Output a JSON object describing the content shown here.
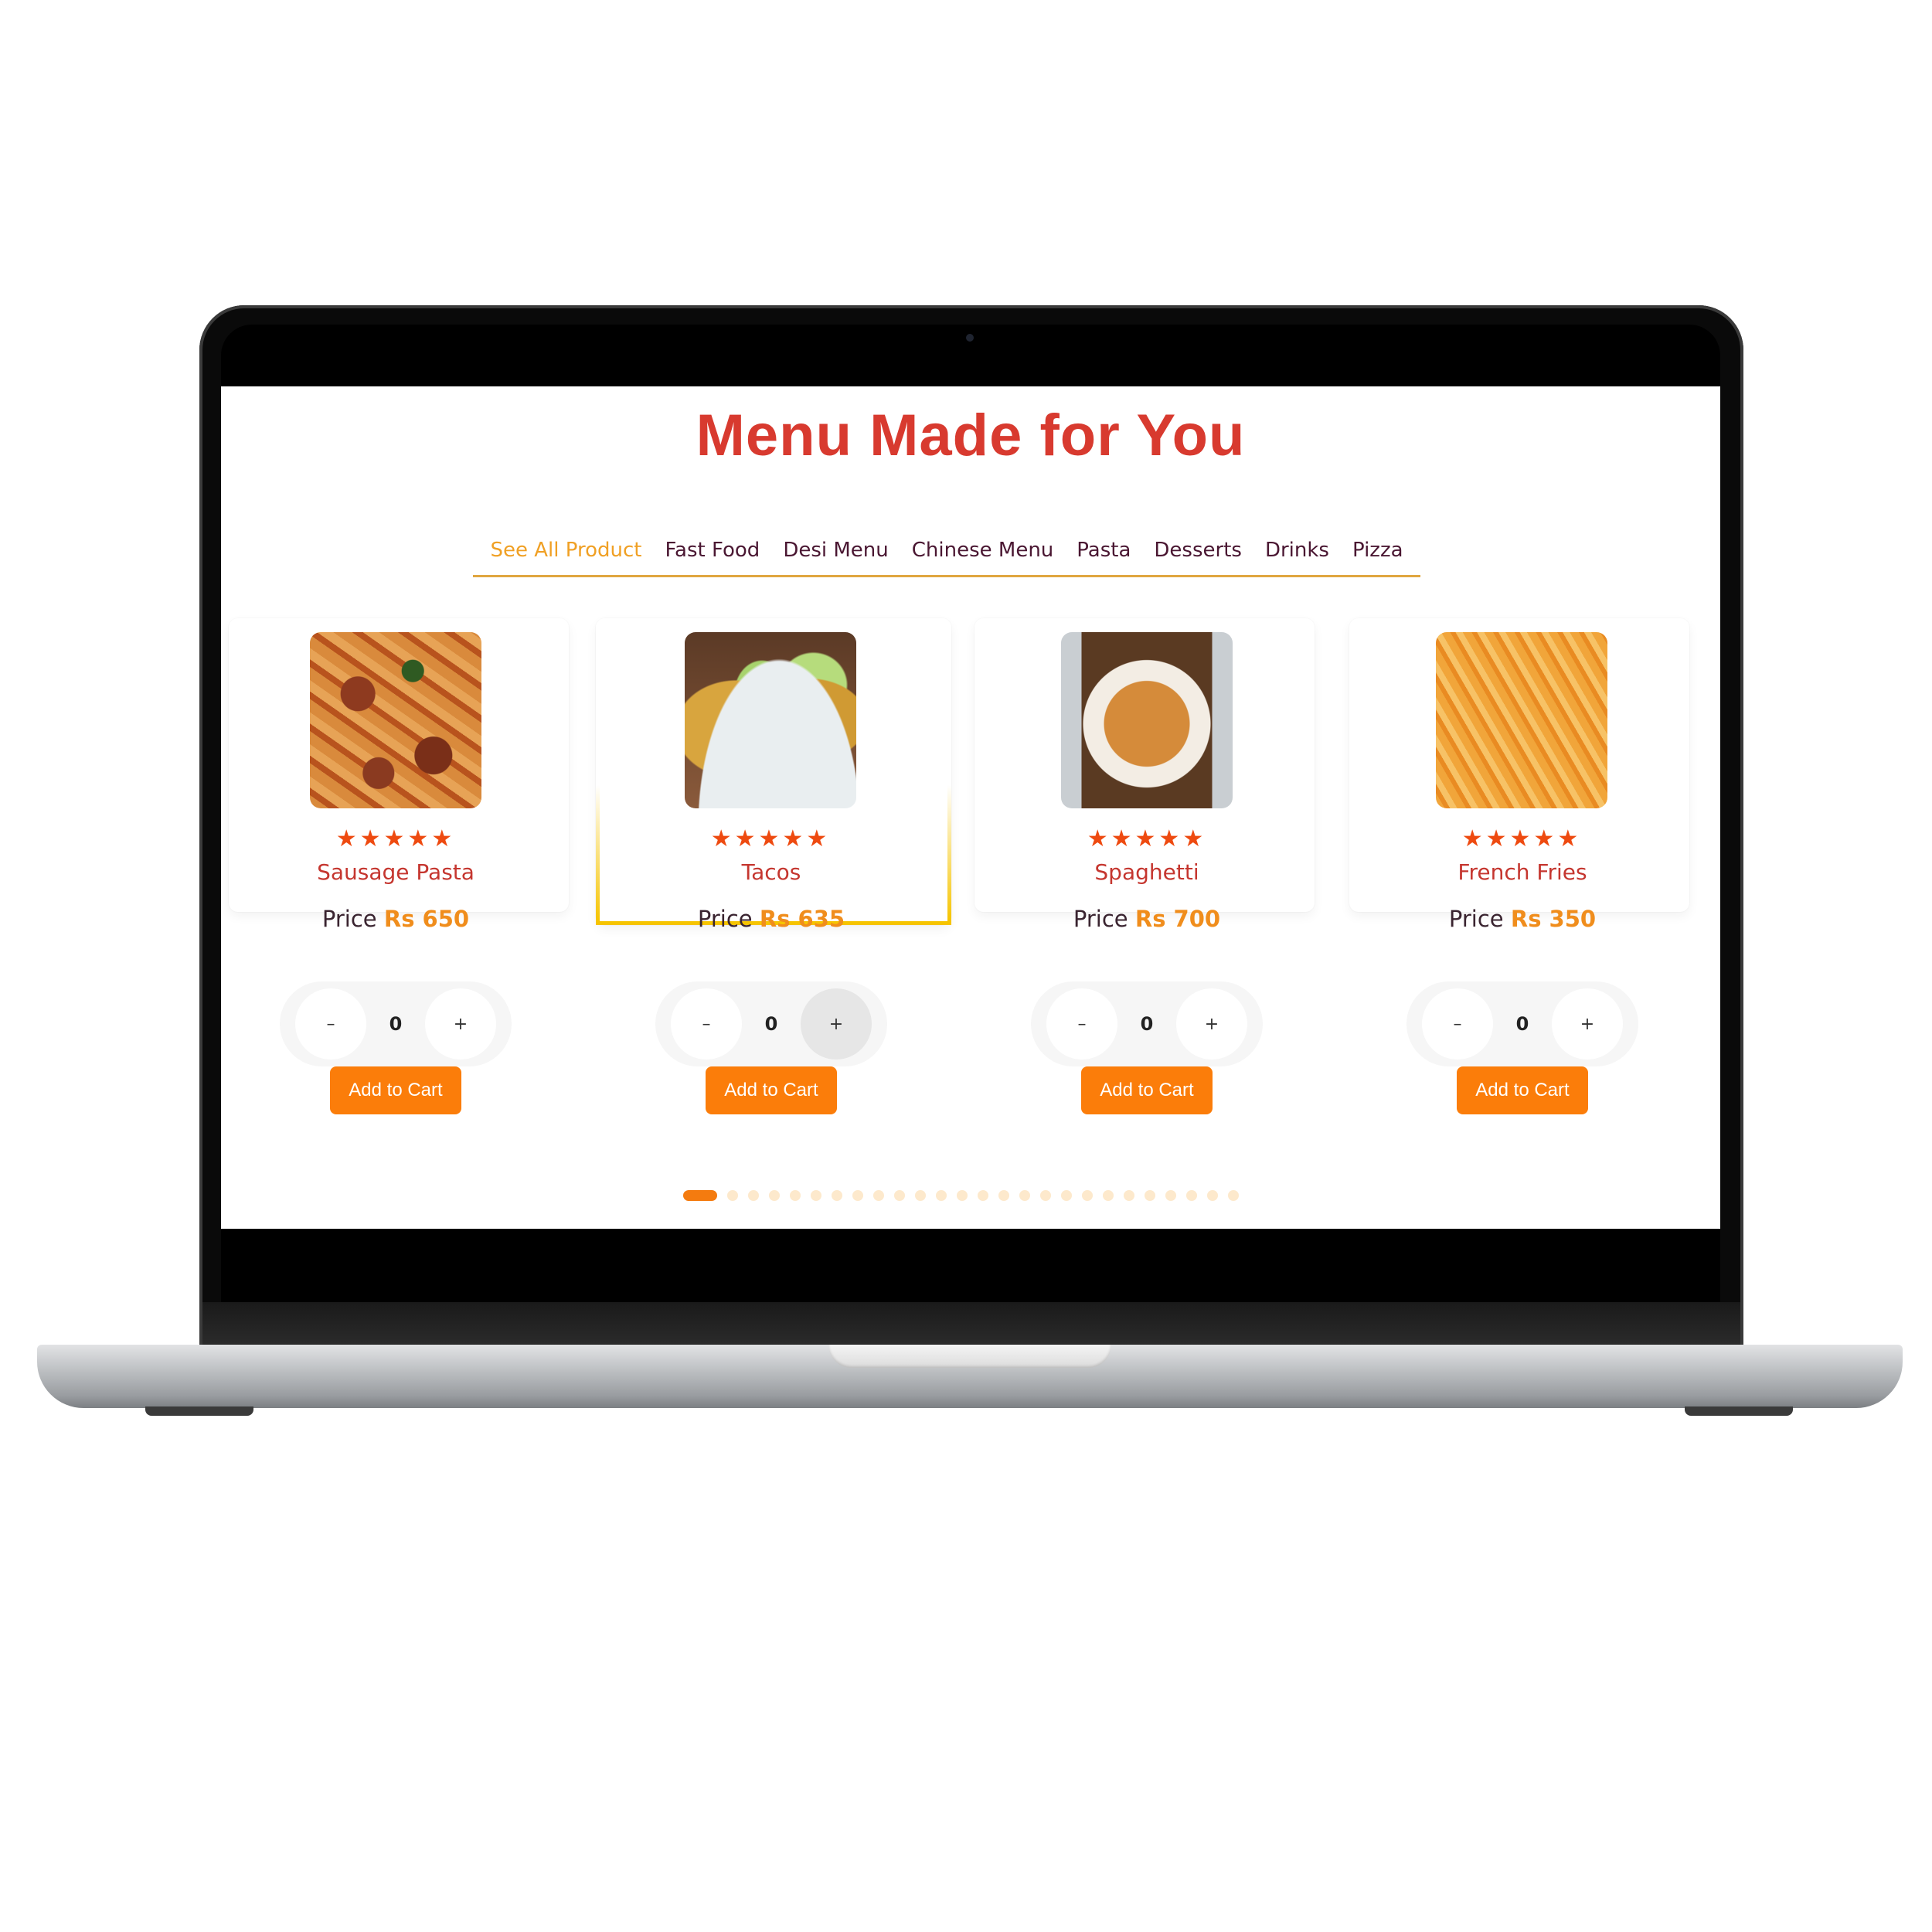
{
  "page": {
    "title": "Menu Made for You"
  },
  "tabs": [
    {
      "label": "See All Product",
      "active": true
    },
    {
      "label": "Fast Food"
    },
    {
      "label": "Desi Menu"
    },
    {
      "label": "Chinese Menu"
    },
    {
      "label": "Pasta"
    },
    {
      "label": "Desserts"
    },
    {
      "label": "Drinks"
    },
    {
      "label": "Pizza"
    }
  ],
  "products": [
    {
      "name": "Sausage Pasta",
      "price_label": "Price",
      "price": "Rs 650",
      "rating": 5,
      "stars": "★★★★★",
      "qty": "0",
      "minus": "–",
      "plus": "+",
      "cta": "Add to Cart"
    },
    {
      "name": "Tacos",
      "price_label": "Price",
      "price": "Rs 635",
      "rating": 5,
      "stars": "★★★★★",
      "qty": "0",
      "minus": "–",
      "plus": "+",
      "cta": "Add to Cart"
    },
    {
      "name": "Spaghetti",
      "price_label": "Price",
      "price": "Rs 700",
      "rating": 5,
      "stars": "★★★★★",
      "qty": "0",
      "minus": "–",
      "plus": "+",
      "cta": "Add to Cart"
    },
    {
      "name": "French Fries",
      "price_label": "Price",
      "price": "Rs 350",
      "rating": 5,
      "stars": "★★★★★",
      "qty": "0",
      "minus": "–",
      "plus": "+",
      "cta": "Add to Cart"
    }
  ],
  "pagination": {
    "total": 26,
    "current": 1
  },
  "colors": {
    "title": "#d83a2f",
    "active_tab": "#f0a024",
    "tab_text": "#4a1732",
    "accent": "#fb7d0a",
    "star": "#ee4a10",
    "price": "#f08d1c",
    "highlight_border": "#f6c400"
  }
}
